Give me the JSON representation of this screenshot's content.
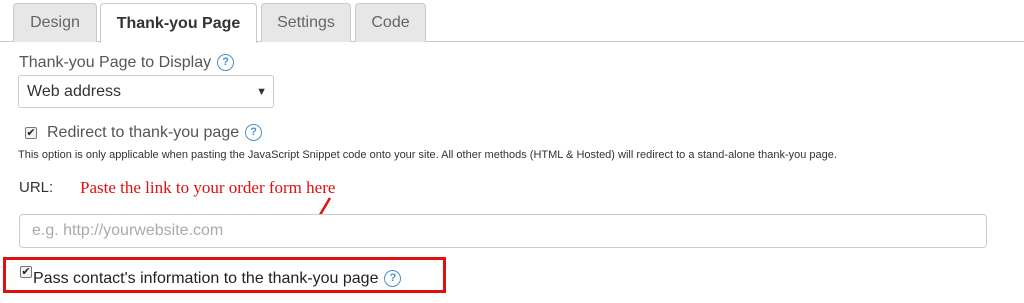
{
  "tabs": [
    {
      "label": "Design"
    },
    {
      "label": "Thank-you Page"
    },
    {
      "label": "Settings"
    },
    {
      "label": "Code"
    }
  ],
  "display": {
    "label": "Thank-you Page to Display",
    "select_value": "Web address"
  },
  "redirect": {
    "checked": true,
    "label": "Redirect to thank-you page",
    "note": "This option is only applicable when pasting the JavaScript Snippet code onto your site. All other methods (HTML & Hosted) will redirect to a stand-alone thank-you page."
  },
  "url": {
    "label": "URL:",
    "placeholder": "e.g. http://yourwebsite.com",
    "annotation": "Paste the link to your order form here"
  },
  "pass_contact": {
    "checked": true,
    "label": "Pass contact's information to the thank-you page"
  },
  "help_glyph": "?",
  "colors": {
    "annotation_red": "#e01010",
    "help_blue": "#4a90c8",
    "tab_inactive_bg": "#e7e7e7"
  }
}
